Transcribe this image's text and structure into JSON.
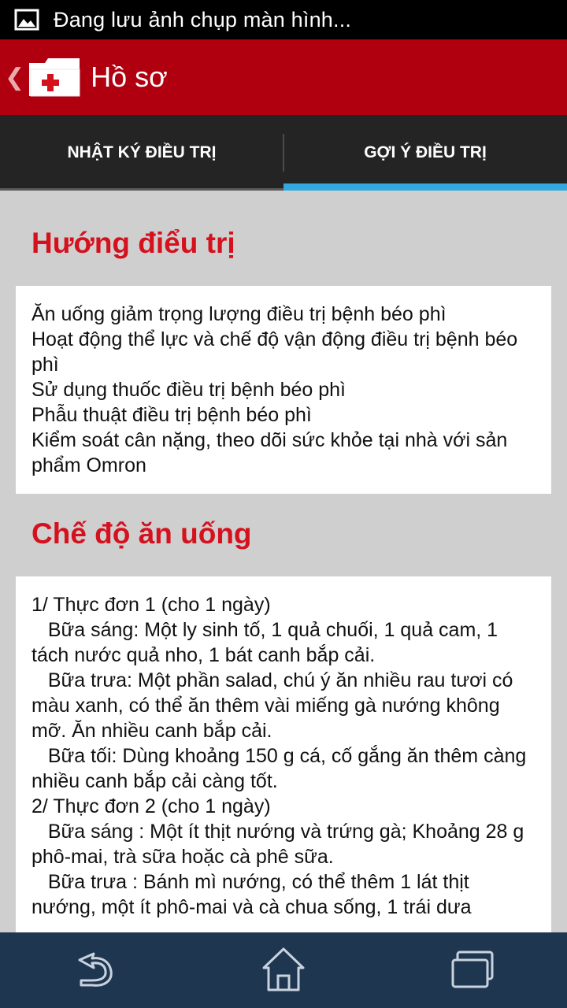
{
  "status_bar": {
    "icon": "image-icon",
    "text": "Đang lưu ảnh chụp màn hình..."
  },
  "header": {
    "title": "Hồ sơ",
    "icon": "medical-folder-icon",
    "color": "#b0000f"
  },
  "tabs": [
    {
      "label": "NHẬT KÝ ĐIỀU TRỊ",
      "active": false
    },
    {
      "label": "GỢI Ý ĐIỀU TRỊ",
      "active": true
    }
  ],
  "accent_color": "#32a8dd",
  "sections": {
    "treatment": {
      "title": "Hướng điểu trị",
      "lines": [
        "Ăn uống giảm trọng lượng điều trị bệnh béo phì",
        "Hoạt động thể lực và chế độ vận động điều trị bệnh béo phì",
        "Sử dụng thuốc điều trị bệnh béo phì",
        "Phẫu thuật điều trị bệnh béo phì",
        "Kiểm soát cân nặng, theo dõi sức khỏe tại nhà với sản phẩm Omron"
      ]
    },
    "diet": {
      "title": "Chế độ ăn uống",
      "lines": [
        "1/ Thực đơn 1 (cho 1 ngày)",
        "   Bữa sáng: Một ly sinh tố, 1 quả chuối, 1 quả cam, 1 tách nước quả nho, 1 bát canh bắp cải.",
        "   Bữa trưa: Một phần salad, chú ý ăn nhiều rau tươi có màu xanh, có thể ăn thêm vài miếng gà nướng không mỡ. Ăn nhiều canh bắp cải.",
        "   Bữa tối: Dùng khoảng 150 g cá, cố gắng ăn thêm càng nhiều canh bắp cải càng tốt.",
        "2/ Thực đơn 2 (cho 1 ngày)",
        "   Bữa sáng : Một ít thịt nướng và trứng gà; Khoảng 28 g phô-mai, trà sữa hoặc cà phê sữa.",
        "   Bữa trưa : Bánh mì nướng, có thể thêm 1 lát thịt nướng, một ít phô-mai và cà chua sống, 1 trái dưa"
      ]
    }
  },
  "bottom_nav": {
    "background": "#1f3650",
    "buttons": [
      "back-icon",
      "home-icon",
      "recent-apps-icon"
    ]
  }
}
